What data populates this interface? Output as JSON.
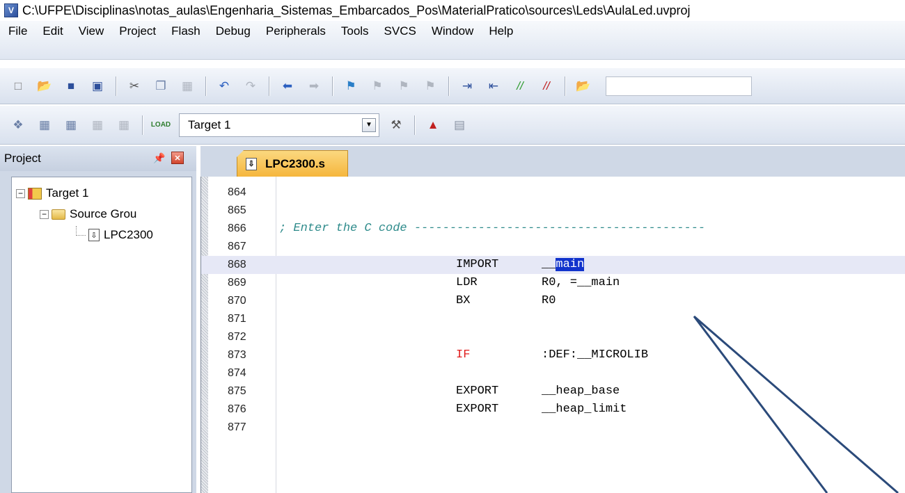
{
  "window": {
    "title": "C:\\UFPE\\Disciplinas\\notas_aulas\\Engenharia_Sistemas_Embarcados_Pos\\MaterialPratico\\sources\\Leds\\AulaLed.uvproj"
  },
  "menu": [
    "File",
    "Edit",
    "View",
    "Project",
    "Flash",
    "Debug",
    "Peripherals",
    "Tools",
    "SVCS",
    "Window",
    "Help"
  ],
  "build_toolbar": {
    "target_value": "Target 1"
  },
  "project_panel": {
    "title": "Project",
    "tree": {
      "target": "Target 1",
      "group": "Source Grou",
      "file": "LPC2300"
    }
  },
  "editor": {
    "active_tab": "LPC2300.s",
    "lines": [
      {
        "num": "864"
      },
      {
        "num": "865"
      },
      {
        "num": "866",
        "comment": "; Enter the C code -----------------------------------------"
      },
      {
        "num": "867"
      },
      {
        "num": "868",
        "instr": "IMPORT",
        "op_plain": "__",
        "op_sel": "main"
      },
      {
        "num": "869",
        "instr": "LDR",
        "operand": "R0, =__main"
      },
      {
        "num": "870",
        "instr": "BX",
        "operand": "R0"
      },
      {
        "num": "871"
      },
      {
        "num": "872"
      },
      {
        "num": "873",
        "instr": "IF",
        "operand": ":DEF:__MICROLIB"
      },
      {
        "num": "874"
      },
      {
        "num": "875",
        "instr": "EXPORT",
        "operand": "__heap_base"
      },
      {
        "num": "876",
        "instr": "EXPORT",
        "operand": "__heap_limit"
      },
      {
        "num": "877"
      }
    ]
  },
  "colors": {
    "comment": "#2e8b8b",
    "keyword_red": "#e01c1c",
    "selection": "#1133cc",
    "tab": "#f5b63d",
    "arrow": "#2b4a7a"
  }
}
